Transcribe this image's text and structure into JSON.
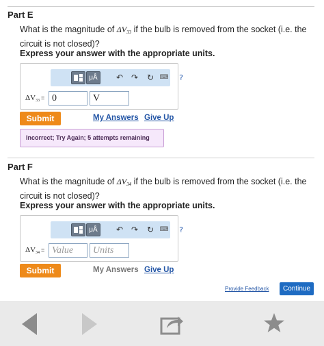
{
  "partE": {
    "title": "Part E",
    "question_before": "What is the magnitude of ",
    "symbol": "ΔV",
    "symbol_sub": "33",
    "question_after": " if the bulb is removed from the socket (i.e. the circuit is not closed)?",
    "instruction": "Express your answer with the appropriate units.",
    "label_symbol": "ΔV",
    "label_sub": "33",
    "label_eq": "=",
    "value": "0",
    "units": "V",
    "submit": "Submit",
    "my_answers": "My Answers",
    "give_up": "Give Up",
    "feedback": "Incorrect; Try Again; 5 attempts remaining"
  },
  "partF": {
    "title": "Part F",
    "question_before": "What is the magnitude of ",
    "symbol": "ΔV",
    "symbol_sub": "34",
    "question_after": " if the bulb is removed from the socket (i.e. the circuit is not closed)?",
    "instruction": "Express your answer with the appropriate units.",
    "label_symbol": "ΔV",
    "label_sub": "34",
    "label_eq": "=",
    "value_placeholder": "Value",
    "units_placeholder": "Units",
    "submit": "Submit",
    "my_answers": "My Answers",
    "give_up": "Give Up"
  },
  "toolbar": {
    "mu_label": "μÅ",
    "undo": "↶",
    "redo": "↷",
    "reset": "↻",
    "keyboard": "⌨",
    "help": "?"
  },
  "footer": {
    "provide_feedback": "Provide Feedback",
    "continue": "Continue"
  },
  "bottom_nav": {
    "icons": [
      "back-arrow-icon",
      "forward-arrow-icon",
      "share-icon",
      "star-icon"
    ]
  },
  "colors": {
    "submit": "#ee8a1a",
    "link": "#2456a6",
    "continue": "#1e6bc2",
    "feedback_bg": "#f6e8fb",
    "toolbar_bg": "#cfe2f4"
  }
}
